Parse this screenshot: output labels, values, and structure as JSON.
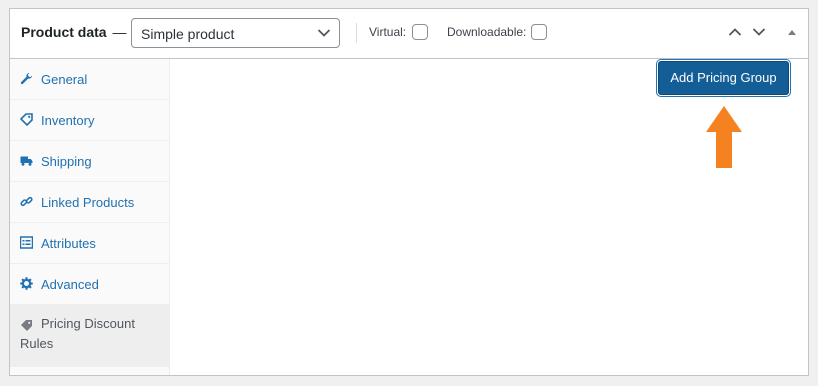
{
  "header": {
    "title": "Product data",
    "dash": "—",
    "product_type": "Simple product",
    "virtual_label": "Virtual:",
    "downloadable_label": "Downloadable:"
  },
  "tabs": [
    {
      "label": "General",
      "icon": "wrench-icon"
    },
    {
      "label": "Inventory",
      "icon": "tag-icon"
    },
    {
      "label": "Shipping",
      "icon": "truck-icon"
    },
    {
      "label": "Linked Products",
      "icon": "link-icon"
    },
    {
      "label": "Attributes",
      "icon": "list-icon"
    },
    {
      "label": "Advanced",
      "icon": "gear-icon"
    },
    {
      "label": "Pricing Discount Rules",
      "icon": "tag-icon"
    }
  ],
  "main": {
    "add_button": "Add Pricing Group"
  },
  "colors": {
    "accent": "#2271b1",
    "button": "#135e96",
    "arrow": "#f58220"
  }
}
